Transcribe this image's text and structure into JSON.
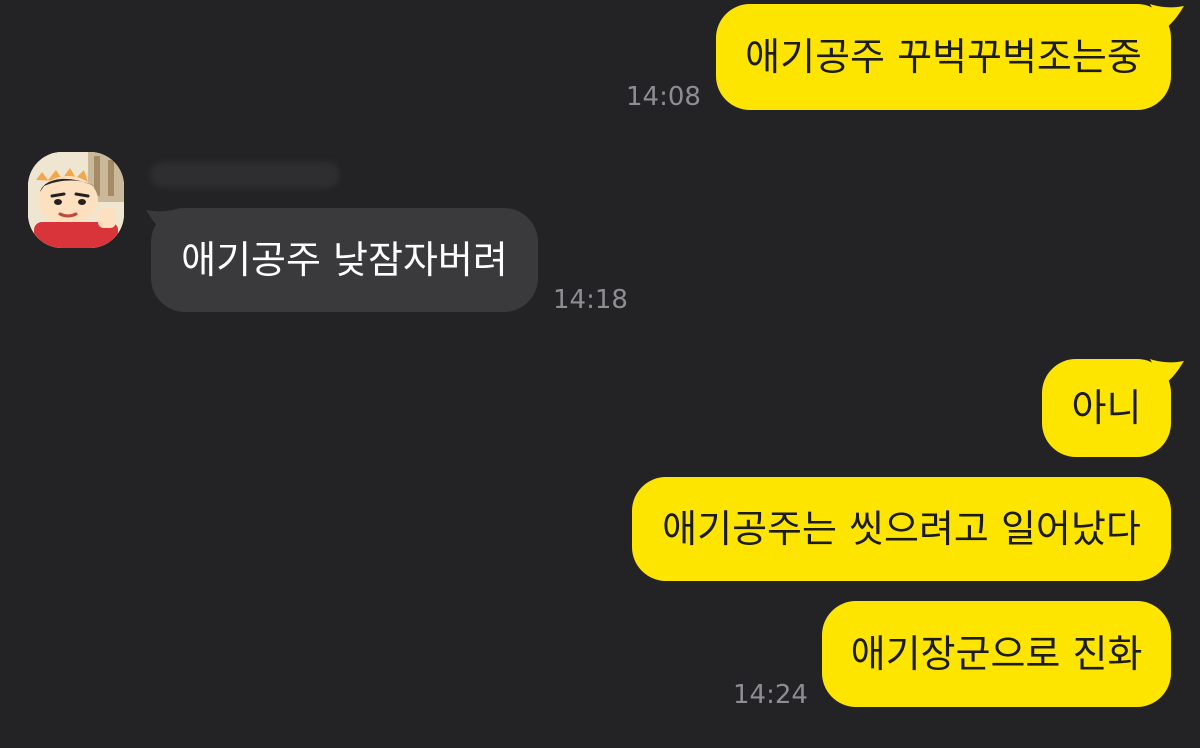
{
  "colors": {
    "background": "#232325",
    "my_bubble": "#FEE500",
    "their_bubble": "#3a3a3c",
    "timestamp": "#8d8d92"
  },
  "messages": [
    {
      "from": "me",
      "text": "애기공주 꾸벅꾸벅조는중",
      "time": "14:08"
    },
    {
      "from": "them",
      "text": "애기공주 낮잠자버려",
      "time": "14:18"
    },
    {
      "from": "me",
      "text": "아니",
      "time": ""
    },
    {
      "from": "me",
      "text": "애기공주는 씻으려고 일어났다",
      "time": ""
    },
    {
      "from": "me",
      "text": "애기장군으로 진화",
      "time": "14:24"
    }
  ],
  "contact": {
    "avatar_icon": "cartoon-boy-avatar-icon"
  }
}
